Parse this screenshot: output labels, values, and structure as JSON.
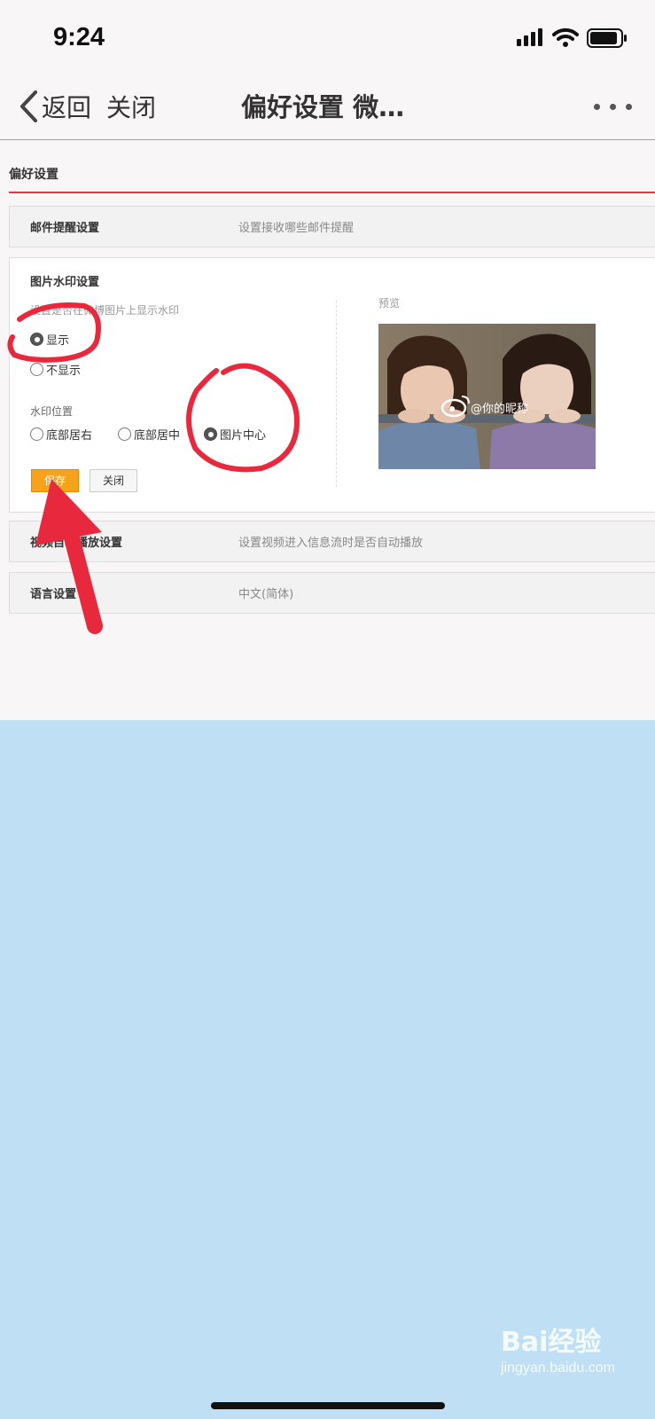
{
  "status_bar": {
    "time": "9:24"
  },
  "nav": {
    "back": "返回",
    "close": "关闭",
    "title": "偏好设置 微…"
  },
  "page": {
    "heading": "偏好设置",
    "mail": {
      "title": "邮件提醒设置",
      "desc": "设置接收哪些邮件提醒"
    },
    "watermark": {
      "title": "图片水印设置",
      "subtitle": "设置是否在微博图片上显示水印",
      "show": "显示",
      "hide": "不显示",
      "selected_visibility": "显示",
      "position_label": "水印位置",
      "positions": [
        "底部居右",
        "底部居中",
        "图片中心"
      ],
      "selected_position": "图片中心",
      "save": "保存",
      "close": "关闭",
      "preview_label": "预览",
      "preview_watermark": "@你的昵称"
    },
    "video": {
      "title": "视频自动播放设置",
      "desc": "设置视频进入信息流时是否自动播放"
    },
    "language": {
      "title": "语言设置",
      "value": "中文(简体)"
    }
  },
  "footer_watermark": {
    "brand": "Bai经验",
    "url": "jingyan.baidu.com"
  },
  "colors": {
    "accent_red": "#e03a3a",
    "save_orange": "#f7a21b",
    "annotation_red": "#e8283c",
    "page_bg": "#bfe0f4"
  }
}
